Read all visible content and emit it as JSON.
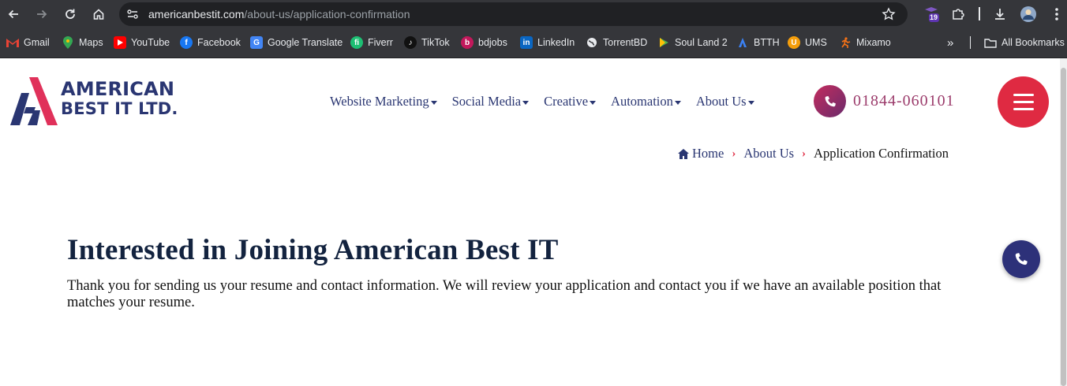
{
  "browser": {
    "url_domain": "americanbestit.com",
    "url_path": "/about-us/application-confirmation",
    "extension_badge": "19",
    "bookmarks": [
      {
        "label": "Gmail",
        "icon": "gmail-icon",
        "color": "#ea4335"
      },
      {
        "label": "Maps",
        "icon": "maps-icon",
        "color": "#34a853"
      },
      {
        "label": "YouTube",
        "icon": "youtube-icon",
        "color": "#ff0000"
      },
      {
        "label": "Facebook",
        "icon": "facebook-icon",
        "color": "#1877f2"
      },
      {
        "label": "Google Translate",
        "icon": "google-translate-icon",
        "color": "#4285f4"
      },
      {
        "label": "Fiverr",
        "icon": "fiverr-icon",
        "color": "#1dbf73"
      },
      {
        "label": "TikTok",
        "icon": "tiktok-icon",
        "color": "#000000"
      },
      {
        "label": "bdjobs",
        "icon": "bdjobs-icon",
        "color": "#c2185b"
      },
      {
        "label": "LinkedIn",
        "icon": "linkedin-icon",
        "color": "#0a66c2"
      },
      {
        "label": "TorrentBD",
        "icon": "globe-icon",
        "color": "#e8eaed"
      },
      {
        "label": "Soul Land 2",
        "icon": "play-icon",
        "color": "#4caf50"
      },
      {
        "label": "BTTH",
        "icon": "btth-icon",
        "color": "#3b82f6"
      },
      {
        "label": "UMS",
        "icon": "ums-icon",
        "color": "#f59e0b"
      },
      {
        "label": "Mixamo",
        "icon": "mixamo-icon",
        "color": "#f97316"
      }
    ],
    "all_bookmarks_label": "All Bookmarks"
  },
  "site": {
    "logo": {
      "line1": "AMERICAN",
      "line2": "BEST IT LTD."
    },
    "nav": [
      {
        "label": "Website Marketing"
      },
      {
        "label": "Social Media"
      },
      {
        "label": "Creative"
      },
      {
        "label": "Automation"
      },
      {
        "label": "About Us"
      }
    ],
    "phone": "01844-060101",
    "breadcrumb": {
      "home": "Home",
      "parent": "About Us",
      "current": "Application Confirmation"
    },
    "heading": "Interested in Joining American Best IT",
    "body": "Thank you for sending us your resume and contact information. We will review your application and contact you if we have an available position that matches your resume."
  },
  "colors": {
    "brand_navy": "#2a3672",
    "brand_red": "#df2a42",
    "heading": "#13233f",
    "phone_text": "#9b3b6b",
    "chrome_bg": "#35363a"
  }
}
